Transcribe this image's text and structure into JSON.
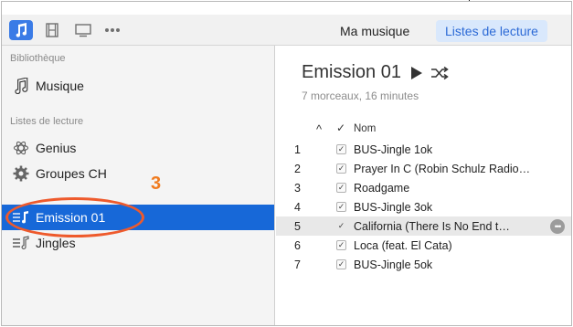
{
  "toolbar": {
    "media_buttons": [
      {
        "icon": "music-note-icon",
        "active": true
      },
      {
        "icon": "film-icon",
        "active": false
      },
      {
        "icon": "tv-icon",
        "active": false
      },
      {
        "icon": "more-dots-icon",
        "active": false
      }
    ],
    "nav": {
      "my_music": "Ma musique",
      "playlists": "Listes de lecture"
    },
    "selected_nav": "playlists"
  },
  "sidebar": {
    "library_header": "Bibliothèque",
    "library_items": [
      {
        "icon": "music-note-icon",
        "label": "Musique"
      }
    ],
    "playlists_header": "Listes de lecture",
    "playlist_items": [
      {
        "icon": "genius-atom-icon",
        "label": "Genius"
      },
      {
        "icon": "gear-icon",
        "label": "Groupes CH"
      },
      {
        "icon": "playlist-icon",
        "label": "Emission 01",
        "selected": true
      },
      {
        "icon": "playlist-icon",
        "label": "Jingles"
      }
    ],
    "annotation_number": "3"
  },
  "main": {
    "playlist_title": "Emission 01",
    "playlist_subtitle": "7 morceaux, 16 minutes",
    "columns": {
      "sort": "^",
      "check": "✓",
      "name": "Nom"
    },
    "tracks": [
      {
        "num": "1",
        "title": "BUS-Jingle 1ok"
      },
      {
        "num": "2",
        "title": "Prayer In C (Robin Schulz Radio…"
      },
      {
        "num": "3",
        "title": "Roadgame"
      },
      {
        "num": "4",
        "title": "BUS-Jingle 3ok"
      },
      {
        "num": "5",
        "title": "California (There Is No End t…",
        "highlighted": true
      },
      {
        "num": "6",
        "title": "Loca (feat. El Cata)"
      },
      {
        "num": "7",
        "title": "BUS-Jingle 5ok"
      }
    ]
  },
  "colors": {
    "accent": "#1768d8",
    "selected_nav_bg": "#d9e8fc",
    "annotation": "#ee5a2c"
  }
}
